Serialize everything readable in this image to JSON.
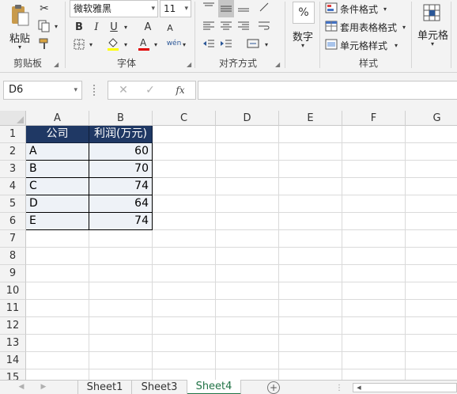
{
  "ribbon": {
    "clipboard": {
      "paste_label": "粘贴",
      "group_label": "剪贴板"
    },
    "font": {
      "font_name": "微软雅黑",
      "font_size": "11",
      "bold": "B",
      "italic": "I",
      "underline": "U",
      "grow": "A",
      "shrink": "A",
      "group_label": "字体"
    },
    "alignment": {
      "group_label": "对齐方式"
    },
    "number": {
      "label": "数字",
      "percent": "%"
    },
    "styles": {
      "conditional": "条件格式",
      "table_format": "套用表格格式",
      "cell_styles": "单元格样式",
      "group_label": "样式"
    },
    "cells": {
      "label": "单元格"
    }
  },
  "formula_bar": {
    "name_box": "D6",
    "fx": "fx",
    "formula": ""
  },
  "grid": {
    "columns": [
      "A",
      "B",
      "C",
      "D",
      "E",
      "F",
      "G"
    ],
    "rows": [
      "1",
      "2",
      "3",
      "4",
      "5",
      "6",
      "7",
      "8",
      "9",
      "10",
      "11",
      "12",
      "13",
      "14",
      "15"
    ],
    "table_header": [
      "公司",
      "利润(万元)"
    ],
    "table_rows": [
      {
        "company": "A",
        "profit": "60"
      },
      {
        "company": "B",
        "profit": "70"
      },
      {
        "company": "C",
        "profit": "74"
      },
      {
        "company": "D",
        "profit": "64"
      },
      {
        "company": "E",
        "profit": "74"
      }
    ]
  },
  "sheet_tabs": [
    "Sheet1",
    "Sheet3",
    "Sheet4"
  ],
  "active_tab": "Sheet4",
  "colors": {
    "header_fill": "#1f3864",
    "accent": "#217346"
  }
}
